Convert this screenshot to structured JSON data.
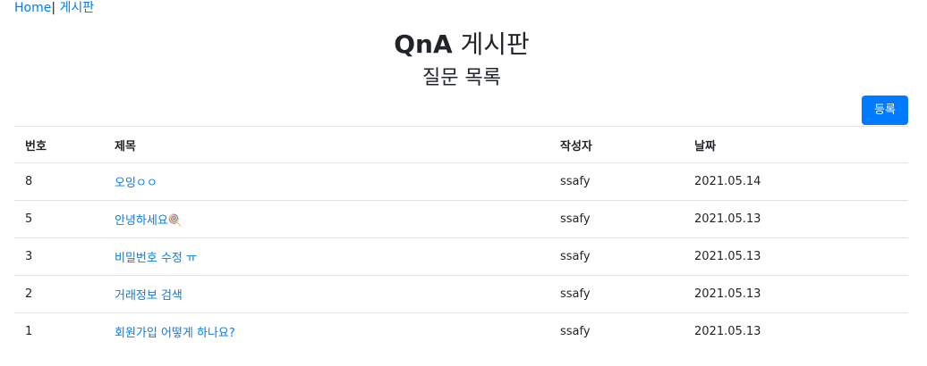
{
  "nav": {
    "home": "Home",
    "separator": "|",
    "board": "게시판"
  },
  "header": {
    "title_strong": "QnA",
    "title_rest": "게시판",
    "subtitle": "질문 목록"
  },
  "actions": {
    "register_label": "등록"
  },
  "table": {
    "headers": [
      "번호",
      "제목",
      "작성자",
      "날짜"
    ],
    "rows": [
      {
        "no": "8",
        "title": "오잉ㅇㅇ",
        "author": "ssafy",
        "date": "2021.05.14"
      },
      {
        "no": "5",
        "title": "안녕하세요🍭",
        "author": "ssafy",
        "date": "2021.05.13"
      },
      {
        "no": "3",
        "title": "비밀번호 수정 ㅠ",
        "author": "ssafy",
        "date": "2021.05.13"
      },
      {
        "no": "2",
        "title": "거래정보 검색",
        "author": "ssafy",
        "date": "2021.05.13"
      },
      {
        "no": "1",
        "title": "회원가입 어떻게 하나요?",
        "author": "ssafy",
        "date": "2021.05.13"
      }
    ]
  }
}
